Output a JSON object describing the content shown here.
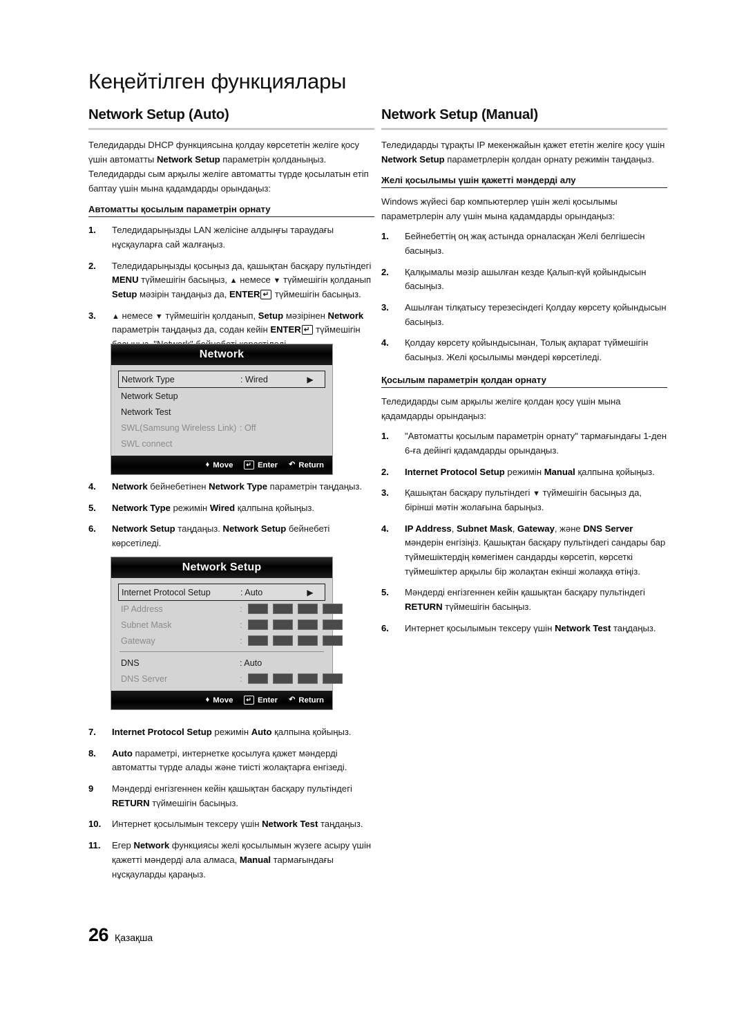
{
  "chapter_title": "Кеңейтілген функциялары",
  "left_column": {
    "heading": "Network Setup (Auto)",
    "intro": "Теледидарды DHCP функциясына қолдау көрсететін желіге қосу үшін автоматты <b>Network Setup</b> параметрін қолданыңыз. Теледидарды сым арқылы желіге автоматты түрде қосылатын етіп баптау үшін мына қадамдарды орындаңыз:",
    "sub_head": "Автоматты қосылым параметрін орнату",
    "steps_1_3": [
      {
        "num": "1.",
        "html": "Теледидарыңызды LAN желісіне алдыңғы тараудағы нұсқауларға сай жалғаңыз."
      },
      {
        "num": "2.",
        "html": "Теледидарыңызды қосыңыз да, қашықтан басқару пультіндегі <b>MENU</b> түймешігін басыңыз, <span class=\"arrow-g\">▲</span> немесе <span class=\"arrow-g\">▼</span> түймешігін қолданып <b>Setup</b> мәзірін таңдаңыз да, <b>ENTER</b><span class=\"keycap\">↵</span> түймешігін басыңыз."
      },
      {
        "num": "3.",
        "html": "<span class=\"arrow-g\">▲</span> немесе <span class=\"arrow-g\">▼</span> түймешігін қолданып, <b>Setup</b> мәзірінен <b>Network</b> параметрін таңдаңыз да, содан кейін <b>ENTER</b><span class=\"keycap\">↵</span> түймешігін басыңыз. \"Network\" бейнебеті көрсетіледі."
      }
    ],
    "steps_4_6": [
      {
        "num": "4.",
        "html": "<b>Network</b> бейнебетінен <b>Network Type</b> параметрін таңдаңыз."
      },
      {
        "num": "5.",
        "html": "<b>Network Type</b> режимін <b>Wired</b> қалпына қойыңыз."
      },
      {
        "num": "6.",
        "html": "<b>Network Setup</b> таңдаңыз. <b>Network Setup</b> бейнебеті көрсетіледі."
      }
    ],
    "steps_7_11": [
      {
        "num": "7.",
        "html": "<b>Internet Protocol Setup</b> режимін <b>Auto</b> қалпына қойыңыз."
      },
      {
        "num": "8.",
        "html": "<b>Auto</b> параметрі, интернетке қосылуға қажет мәндерді автоматты түрде алады және тиісті жолақтарға енгізеді."
      },
      {
        "num": "9",
        "html": "Мәндерді енгізгеннен кейін қашықтан басқару пультіндегі <b>RETURN</b> түймешігін басыңыз."
      },
      {
        "num": "10.",
        "html": "Интернет қосылымын тексеру үшін <b>Network Test</b> таңдаңыз."
      },
      {
        "num": "11.",
        "html": "Егер <b>Network</b> функциясы желі қосылымын жүзеге асыру үшін қажетті мәндерді ала алмаса, <b>Manual</b> тармағындағы нұсқауларды қараңыз."
      }
    ]
  },
  "right_column": {
    "heading": "Network Setup (Manual)",
    "intro": "Теледидарды тұрақты IP мекенжайын қажет ететін желіге қосу үшін <b>Network Setup</b> параметрлерін қолдан орнату режимін таңдаңыз.",
    "sub_head_1": "Желі қосылымы үшін қажетті мәндерді алу",
    "intro_2": "Windows жүйесі бар компьютерлер үшін желі қосылымы параметрлерін алу үшін мына қадамдарды орындаңыз:",
    "steps_a": [
      {
        "num": "1.",
        "html": "Бейнебеттің оң жақ астында орналасқан Желі белгішесін басыңыз."
      },
      {
        "num": "2.",
        "html": "Қалқымалы мәзір ашылған кезде Қалып-күй қойындысын басыңыз."
      },
      {
        "num": "3.",
        "html": "Ашылған тілқатысу терезесіндегі Қолдау көрсету қойындысын басыңыз."
      },
      {
        "num": "4.",
        "html": "Қолдау көрсету қойындысынан, Толық ақпарат түймешігін басыңыз. Желі қосылымы мәндері көрсетіледі."
      }
    ],
    "sub_head_2": "Қосылым параметрін қолдан орнату",
    "intro_3": "Теледидарды сым арқылы желіге қолдан қосу үшін мына қадамдарды орындаңыз:",
    "steps_b": [
      {
        "num": "1.",
        "html": "\"Автоматты қосылым параметрін орнату\" тармағындағы 1-ден 6-ға дейінгі қадамдарды орындаңыз."
      },
      {
        "num": "2.",
        "html": "<b>Internet Protocol Setup</b> режимін <b>Manual</b> қалпына қойыңыз."
      },
      {
        "num": "3.",
        "html": "Қашықтан басқару пультіндегі <span class=\"arrow-g\">▼</span> түймешігін басыңыз да, бірінші мәтін жолағына барыңыз."
      },
      {
        "num": "4.",
        "html": "<b>IP Address</b>, <b>Subnet Mask</b>, <b>Gateway</b>, және <b>DNS Server</b> мәндерін енгізіңіз. Қашықтан басқару пультіндегі сандары бар түймешіктердің көмегімен сандарды көрсетіп, көрсеткі түймешіктер арқылы бір жолақтан екінші жолаққа өтіңіз."
      },
      {
        "num": "5.",
        "html": "Мәндерді енгізгеннен кейін қашықтан басқару пультіндегі <b>RETURN</b> түймешігін басыңыз."
      },
      {
        "num": "6.",
        "html": "Интернет қосылымын тексеру үшін <b>Network Test</b> таңдаңыз."
      }
    ]
  },
  "osd_network": {
    "title": "Network",
    "rows": [
      {
        "label": "Network Type",
        "value": ": Wired",
        "caret": "▶",
        "selected": true,
        "dim": false
      },
      {
        "label": "Network Setup",
        "value": "",
        "caret": "",
        "selected": false,
        "dim": false
      },
      {
        "label": "Network Test",
        "value": "",
        "caret": "",
        "selected": false,
        "dim": false
      },
      {
        "label": "SWL(Samsung Wireless Link)",
        "value": ": Off",
        "caret": "",
        "selected": false,
        "dim": true
      },
      {
        "label": "SWL connect",
        "value": "",
        "caret": "",
        "selected": false,
        "dim": true
      }
    ],
    "footer": {
      "move": "Move",
      "enter": "Enter",
      "return": "Return"
    }
  },
  "osd_network_setup": {
    "title": "Network Setup",
    "rows": [
      {
        "label": "Internet Protocol Setup",
        "value": ": Auto",
        "caret": "▶",
        "selected": true,
        "dim": false,
        "octets": false
      },
      {
        "label": "IP Address",
        "value": "",
        "caret": "",
        "selected": false,
        "dim": true,
        "octets": true
      },
      {
        "label": "Subnet Mask",
        "value": "",
        "caret": "",
        "selected": false,
        "dim": true,
        "octets": true
      },
      {
        "label": "Gateway",
        "value": "",
        "caret": "",
        "selected": false,
        "dim": true,
        "octets": true
      },
      {
        "label": "DNS",
        "value": ": Auto",
        "caret": "",
        "selected": false,
        "dim": false,
        "octets": false,
        "separator_before": true
      },
      {
        "label": "DNS Server",
        "value": "",
        "caret": "",
        "selected": false,
        "dim": true,
        "octets": true
      }
    ],
    "footer": {
      "move": "Move",
      "enter": "Enter",
      "return": "Return"
    }
  },
  "footer": {
    "page_number": "26",
    "language": "Қазақша"
  }
}
